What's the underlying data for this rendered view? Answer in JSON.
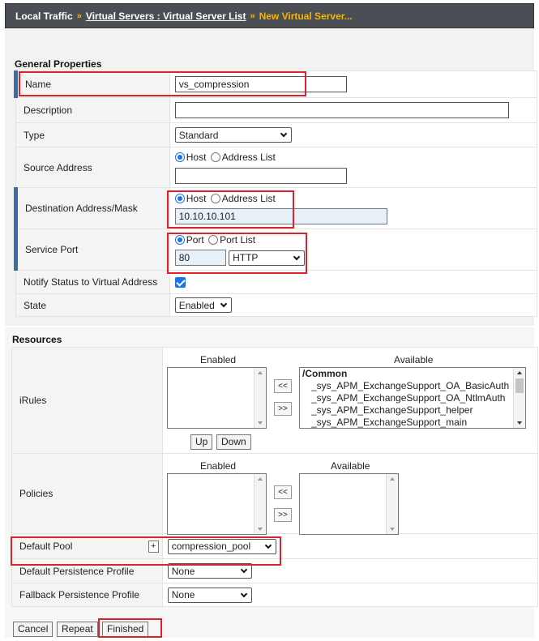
{
  "breadcrumb": {
    "root": "Local Traffic",
    "separator": "»",
    "parent": "Virtual Servers : Virtual Server List",
    "current": "New Virtual Server..."
  },
  "general": {
    "title": "General Properties",
    "name": {
      "label": "Name",
      "value": "vs_compression"
    },
    "description": {
      "label": "Description",
      "value": ""
    },
    "type": {
      "label": "Type",
      "value": "Standard"
    },
    "source": {
      "label": "Source Address",
      "host": "Host",
      "list": "Address List",
      "value": ""
    },
    "destination": {
      "label": "Destination Address/Mask",
      "host": "Host",
      "list": "Address List",
      "value": "10.10.10.101"
    },
    "service_port": {
      "label": "Service Port",
      "port": "Port",
      "list": "Port List",
      "value": "80",
      "protocol": "HTTP"
    },
    "notify": {
      "label": "Notify Status to Virtual Address",
      "checked": true
    },
    "state": {
      "label": "State",
      "value": "Enabled"
    }
  },
  "resources": {
    "title": "Resources",
    "irules": {
      "label": "iRules",
      "enabled_header": "Enabled",
      "available_header": "Available",
      "move_left": "<<",
      "move_right": ">>",
      "available_group": "/Common",
      "available": [
        "_sys_APM_ExchangeSupport_OA_BasicAuth",
        "_sys_APM_ExchangeSupport_OA_NtlmAuth",
        "_sys_APM_ExchangeSupport_helper",
        "_sys_APM_ExchangeSupport_main"
      ],
      "up": "Up",
      "down": "Down"
    },
    "policies": {
      "label": "Policies",
      "enabled_header": "Enabled",
      "available_header": "Available",
      "move_left": "<<",
      "move_right": ">>"
    },
    "default_pool": {
      "label": "Default Pool",
      "plus": "+",
      "value": "compression_pool"
    },
    "default_persistence": {
      "label": "Default Persistence Profile",
      "value": "None"
    },
    "fallback_persistence": {
      "label": "Fallback Persistence Profile",
      "value": "None"
    }
  },
  "actions": {
    "cancel": "Cancel",
    "repeat": "Repeat",
    "finished": "Finished"
  },
  "colors": {
    "header_bg": "#4b4f55",
    "breadcrumb_current": "#f5b400",
    "required_marker": "#3b6ea5",
    "highlight": "#e0202a",
    "accent": "#1a73e8"
  }
}
